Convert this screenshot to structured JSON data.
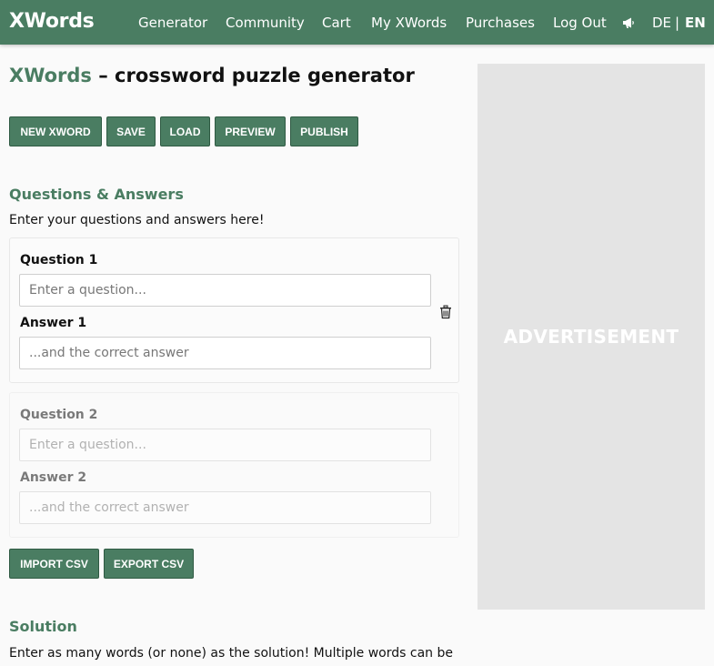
{
  "nav": {
    "brand": "XWords",
    "links": [
      "Generator",
      "Community",
      "Cart",
      "My XWords",
      "Purchases",
      "Log Out"
    ],
    "megaphone_icon": "megaphone-icon",
    "lang_de": "DE",
    "lang_sep": "|",
    "lang_en": "EN"
  },
  "page": {
    "title_brand": "XWords",
    "title_rest": " – crossword puzzle generator"
  },
  "toolbar": {
    "new_label": "NEW XWORD",
    "save_label": "SAVE",
    "load_label": "LOAD",
    "preview_label": "PREVIEW",
    "publish_label": "PUBLISH"
  },
  "qa": {
    "heading": "Questions & Answers",
    "intro": "Enter your questions and answers here!",
    "items": [
      {
        "question_label": "Question 1",
        "question_placeholder": "Enter a question...",
        "answer_label": "Answer 1",
        "answer_placeholder": "...and the correct answer"
      },
      {
        "question_label": "Question 2",
        "question_placeholder": "Enter a question...",
        "answer_label": "Answer 2",
        "answer_placeholder": "...and the correct answer"
      }
    ],
    "delete_icon": "trash-icon",
    "import_label": "IMPORT CSV",
    "export_label": "EXPORT CSV"
  },
  "solution": {
    "heading": "Solution",
    "intro": "Enter as many words (or none) as the solution! Multiple words can be"
  },
  "ad": {
    "label": "ADVERTISEMENT"
  },
  "colors": {
    "brand_green": "#4a7d62",
    "ad_gray": "#e4e4e4"
  }
}
